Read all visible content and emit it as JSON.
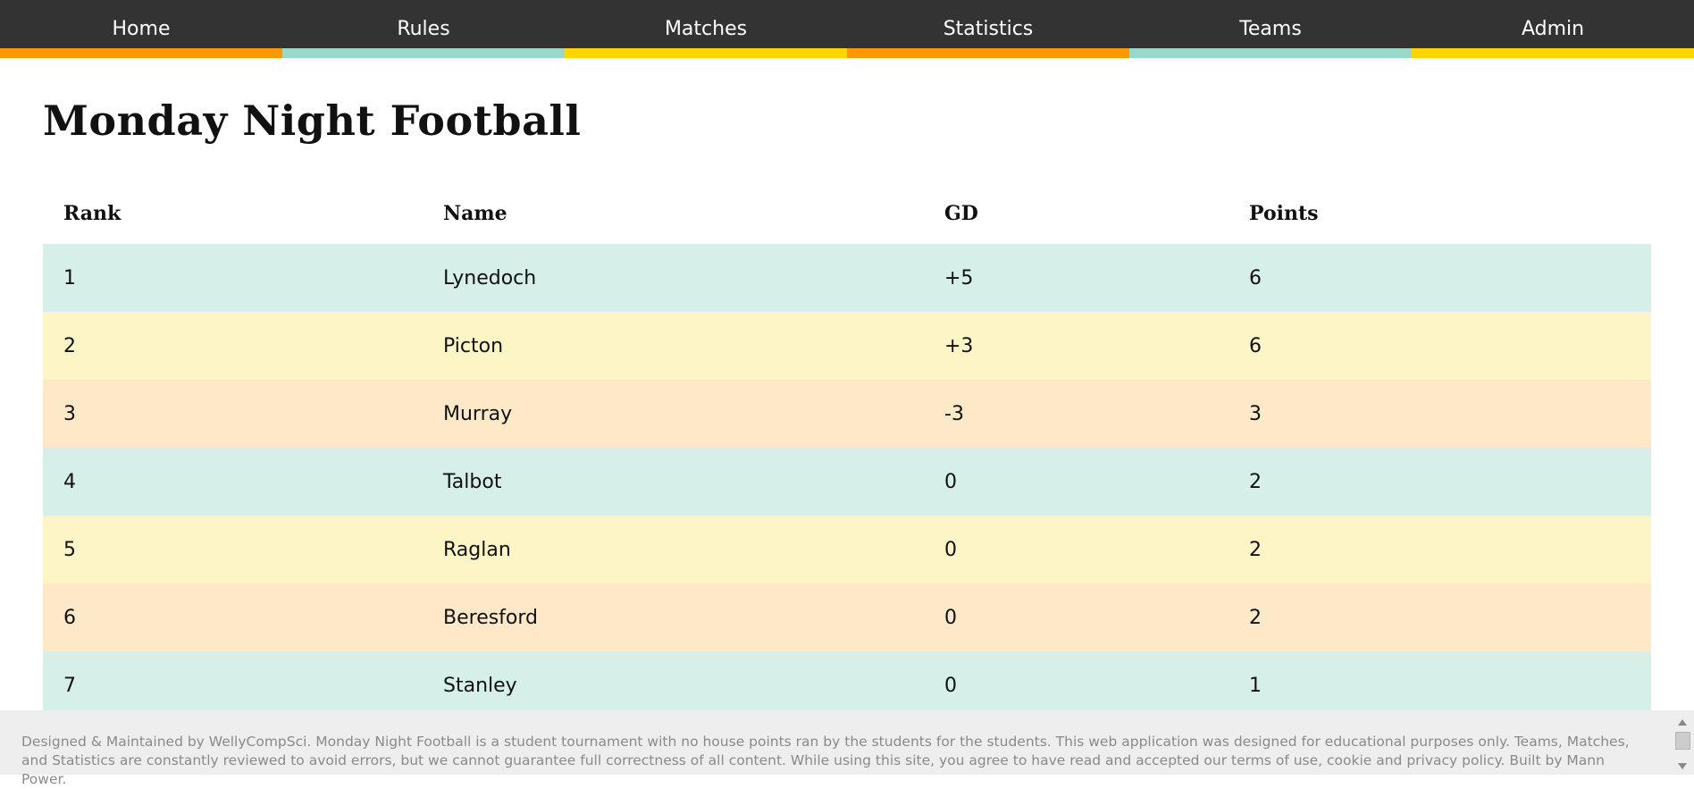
{
  "nav": {
    "items": [
      {
        "label": "Home",
        "accent": "#ff9800"
      },
      {
        "label": "Rules",
        "accent": "#99d9ca"
      },
      {
        "label": "Matches",
        "accent": "#ffd500"
      },
      {
        "label": "Statistics",
        "accent": "#ff9800"
      },
      {
        "label": "Teams",
        "accent": "#99d9ca"
      },
      {
        "label": "Admin",
        "accent": "#ffd500"
      }
    ]
  },
  "page": {
    "title": "Monday Night Football"
  },
  "table": {
    "headers": {
      "rank": "Rank",
      "name": "Name",
      "gd": "GD",
      "points": "Points"
    },
    "rows": [
      {
        "rank": "1",
        "name": "Lynedoch",
        "gd": "+5",
        "points": "6"
      },
      {
        "rank": "2",
        "name": "Picton",
        "gd": "+3",
        "points": "6"
      },
      {
        "rank": "3",
        "name": "Murray",
        "gd": "-3",
        "points": "3"
      },
      {
        "rank": "4",
        "name": "Talbot",
        "gd": "0",
        "points": "2"
      },
      {
        "rank": "5",
        "name": "Raglan",
        "gd": "0",
        "points": "2"
      },
      {
        "rank": "6",
        "name": "Beresford",
        "gd": "0",
        "points": "2"
      },
      {
        "rank": "7",
        "name": "Stanley",
        "gd": "0",
        "points": "1"
      }
    ],
    "row_colors": [
      "#d6efe8",
      "#fdf5c5",
      "#fde8c8"
    ]
  },
  "footer": {
    "text": "Designed & Maintained by WellyCompSci. Monday Night Football is a student tournament with no house points ran by the students for the students. This web application was designed for educational purposes only. Teams, Matches, and Statistics are constantly reviewed to avoid errors, but we cannot guarantee full correctness of all content. While using this site, you agree to have read and accepted our terms of use, cookie and privacy policy. Built by Mann Power."
  }
}
